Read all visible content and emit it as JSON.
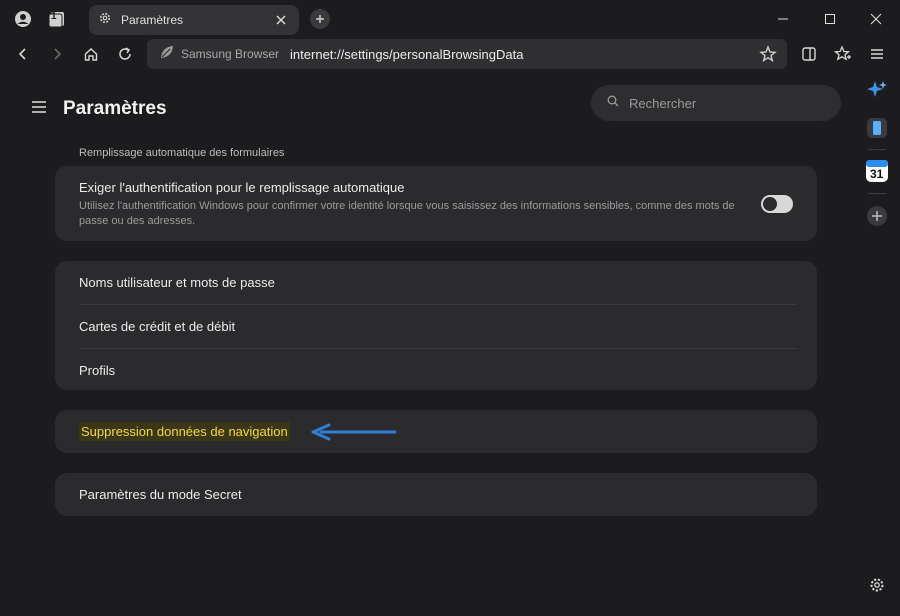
{
  "tab": {
    "title": "Paramètres",
    "count": "1"
  },
  "address": {
    "brand": "Samsung Browser",
    "url": "internet://settings/personalBrowsingData"
  },
  "settings": {
    "title": "Paramètres",
    "search_placeholder": "Rechercher",
    "section_autofill": "Remplissage automatique des formulaires",
    "auth": {
      "title": "Exiger l'authentification pour le remplissage automatique",
      "desc": "Utilisez l'authentification Windows pour confirmer votre identité lorsque vous saisissez des informations sensibles, comme des mots de passe ou des adresses.",
      "enabled": false
    },
    "autofill_items": [
      "Noms utilisateur et mots de passe",
      "Cartes de crédit et de débit",
      "Profils"
    ],
    "clear_data": "Suppression données de navigation",
    "secret_mode": "Paramètres du mode Secret"
  },
  "sidebar": {
    "calendar_day": "31"
  },
  "colors": {
    "background": "#1c1c1e",
    "card": "#2b2b2e",
    "highlight_text": "#f5d63a",
    "arrow": "#2f7fd6"
  }
}
